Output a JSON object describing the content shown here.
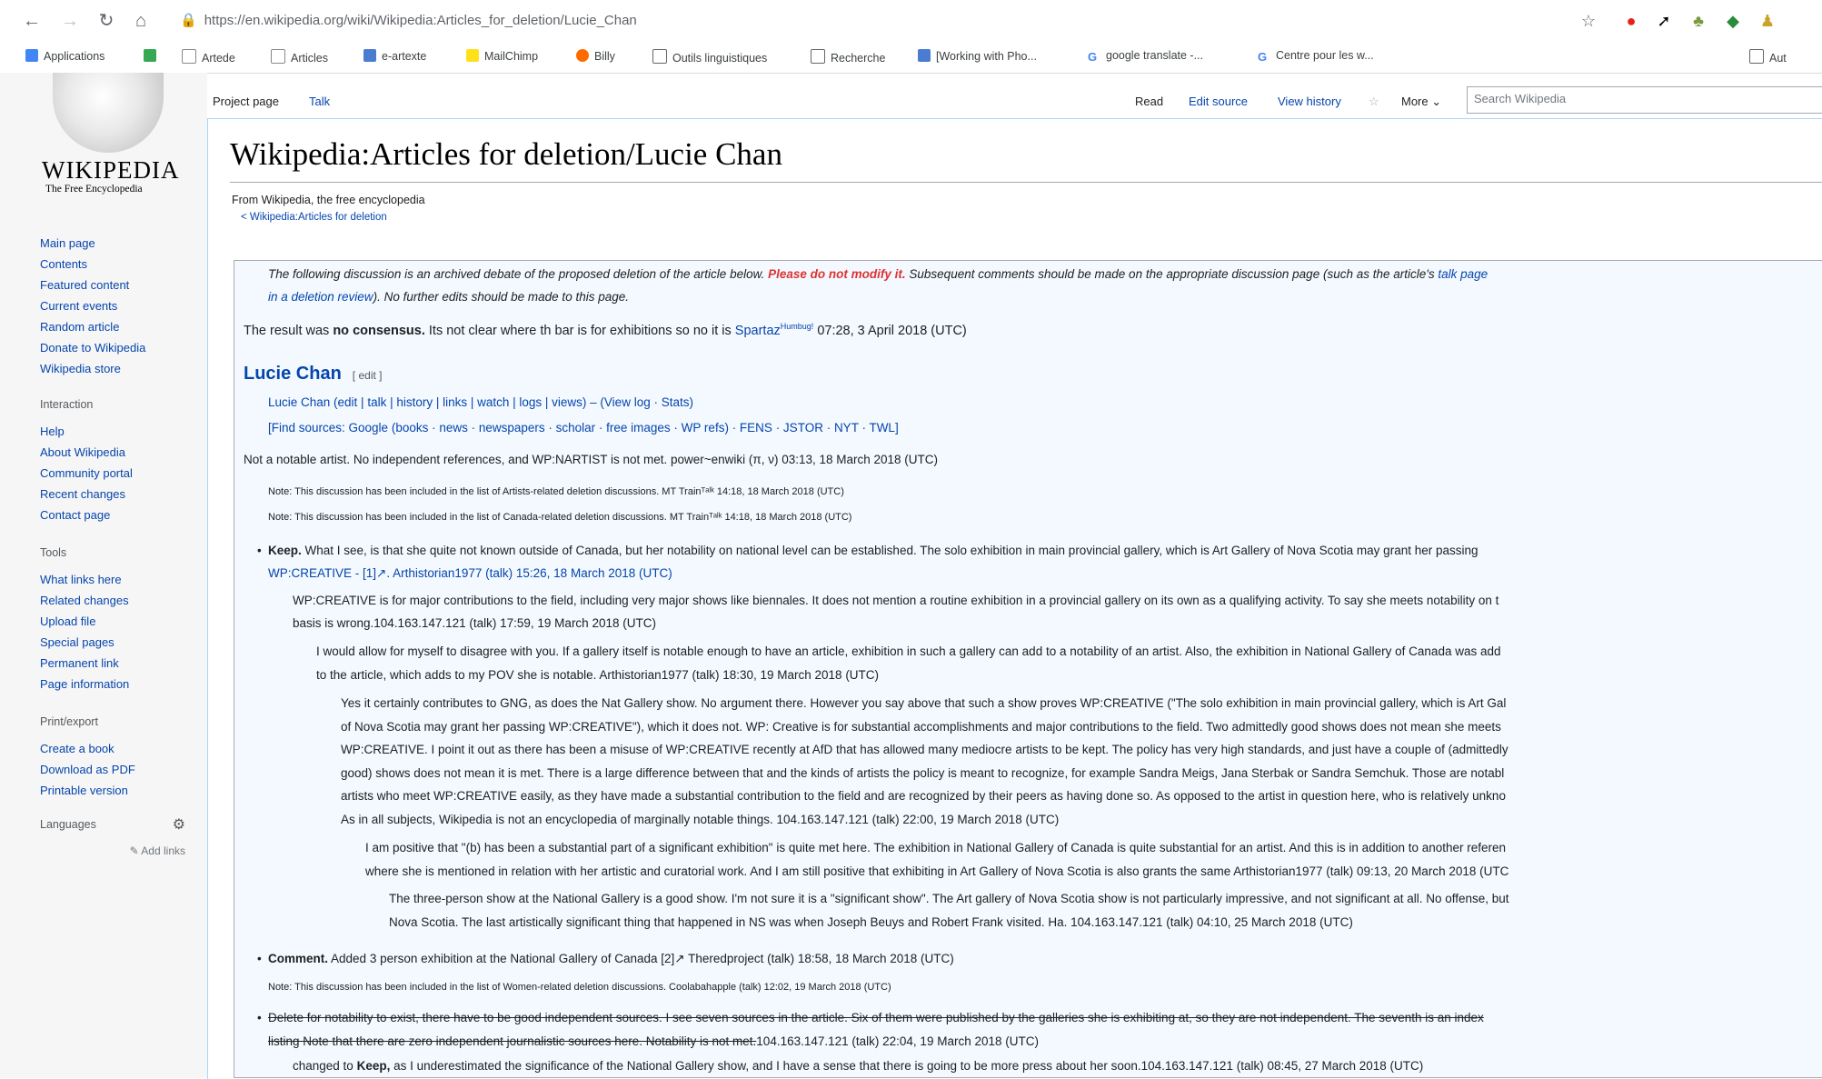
{
  "browser": {
    "url": "https://en.wikipedia.org/wiki/Wikipedia:Articles_for_deletion/Lucie_Chan",
    "bookmarks": [
      "Applications",
      "Artede",
      "Articles",
      "e-artexte",
      "MailChimp",
      "Billy",
      "Outils linguistiques",
      "Recherche",
      "[Working with Pho...",
      "google translate -...",
      "Centre pour les w..."
    ],
    "bookmarks_right": "Aut"
  },
  "logo": {
    "wordmark": "WIKIPEDIA",
    "tagline": "The Free Encyclopedia"
  },
  "sidebar": {
    "nav": [
      "Main page",
      "Contents",
      "Featured content",
      "Current events",
      "Random article",
      "Donate to Wikipedia",
      "Wikipedia store"
    ],
    "interaction_head": "Interaction",
    "interaction": [
      "Help",
      "About Wikipedia",
      "Community portal",
      "Recent changes",
      "Contact page"
    ],
    "tools_head": "Tools",
    "tools": [
      "What links here",
      "Related changes",
      "Upload file",
      "Special pages",
      "Permanent link",
      "Page information"
    ],
    "print_head": "Print/export",
    "print": [
      "Create a book",
      "Download as PDF",
      "Printable version"
    ],
    "languages_head": "Languages",
    "add_links": "Add links"
  },
  "tabs": {
    "project": "Project page",
    "talk": "Talk",
    "read": "Read",
    "edit_source": "Edit source",
    "history": "View history",
    "more": "More",
    "search_placeholder": "Search Wikipedia"
  },
  "page": {
    "title": "Wikipedia:Articles for deletion/Lucie Chan",
    "sitesub": "From Wikipedia, the free encyclopedia",
    "subpages": "< Wikipedia:Articles for deletion"
  },
  "archive": {
    "notice_a": "The following discussion is an archived debate of the proposed deletion of the article below.",
    "notice_red": "Please do not modify it.",
    "notice_b": "Subsequent comments should be made on the appropriate discussion page (such as the article's",
    "notice_link": "talk page",
    "notice_c_link": "in a deletion review",
    "notice_d": "). No further edits should be made to this page.",
    "result_a": "The result was",
    "result_bold": "no consensus.",
    "result_b": "Its not clear where th bar is for exhibitions so no it is",
    "result_user": "Spartaz",
    "result_sup": "Humbug!",
    "result_time": "07:28, 3 April 2018 (UTC)",
    "heading": "Lucie Chan",
    "heading_edit": "[ edit ]",
    "links_row": "Lucie Chan (edit | talk | history | links | watch | logs | views) – (View log · Stats)",
    "sources_row": "[Find sources: Google (books · news · newspapers · scholar · free images · WP refs) · FENS · JSTOR · NYT · TWL]",
    "nom": "Not a notable artist. No independent references, and WP:NARTIST is not met. power~enwiki (π, ν) 03:13, 18 March 2018 (UTC)",
    "note1": "Note: This discussion has been included in the list of Artists-related deletion discussions. MT Trainᵀᵃˡᵏ 14:18, 18 March 2018 (UTC)",
    "note2": "Note: This discussion has been included in the list of Canada-related deletion discussions. MT Trainᵀᵃˡᵏ 14:18, 18 March 2018 (UTC)",
    "keep_bold": "Keep.",
    "keep_1": "What I see, is that she quite not known outside of Canada, but her notability on national level can be established. The solo exhibition in main provincial gallery, which is Art Gallery of Nova Scotia may grant her passing",
    "keep_2": "WP:CREATIVE - [1]↗. Arthistorian1977 (talk) 15:26, 18 March 2018 (UTC)",
    "r1_1": "WP:CREATIVE is for major contributions to the field, including very major shows like biennales. It does not mention a routine exhibition in a provincial gallery on its own as a qualifying activity. To say she meets notability on t",
    "r1_2": "basis is wrong.104.163.147.121 (talk) 17:59, 19 March 2018 (UTC)",
    "r2_1": "I would allow for myself to disagree with you. If a gallery itself is notable enough to have an article, exhibition in such a gallery can add to a notability of an artist. Also, the exhibition in National Gallery of Canada was add",
    "r2_2": "to the article, which adds to my POV she is notable. Arthistorian1977 (talk) 18:30, 19 March 2018 (UTC)",
    "r3_1": "Yes it certainly contributes to GNG, as does the Nat Gallery show. No argument there. However you say above that such a show proves WP:CREATIVE (\"The solo exhibition in main provincial gallery, which is Art Gal",
    "r3_2": "of Nova Scotia may grant her passing WP:CREATIVE\"), which it does not. WP: Creative is for substantial accomplishments and major contributions to the field. Two admittedly good shows does not mean she meets",
    "r3_3": "WP:CREATIVE. I point it out as there has been a misuse of WP:CREATIVE recently at AfD that has allowed many mediocre artists to be kept. The policy has very high standards, and just have a couple of (admittedly",
    "r3_4": "good) shows does not mean it is met. There is a large difference between that and the kinds of artists the policy is meant to recognize, for example Sandra Meigs, Jana Sterbak or Sandra Semchuk. Those are notabl",
    "r3_5": "artists who meet WP:CREATIVE easily, as they have made a substantial contribution to the field and are recognized by their peers as having done so. As opposed to the artist in question here, who is relatively unkno",
    "r3_6": "As in all subjects, Wikipedia is not an encyclopedia of marginally notable things. 104.163.147.121 (talk) 22:00, 19 March 2018 (UTC)",
    "r4_1": "I am positive that \"(b) has been a substantial part of a significant exhibition\" is quite met here. The exhibition in National Gallery of Canada is quite substantial for an artist. And this is in addition to another referen",
    "r4_2": "where she is mentioned in relation with her artistic and curatorial work. And I am still positive that exhibiting in Art Gallery of Nova Scotia is also grants the same Arthistorian1977 (talk) 09:13, 20 March 2018 (UTC",
    "r5_1": "The three-person show at the National Gallery is a good show. I'm not sure it is a \"significant show\". The Art gallery of Nova Scotia show is not particularly impressive, and not significant at all. No offense, but",
    "r5_2": "Nova Scotia. The last artistically significant thing that happened in NS was when Joseph Beuys and Robert Frank visited. Ha. 104.163.147.121 (talk) 04:10, 25 March 2018 (UTC)",
    "comment_bold": "Comment.",
    "comment_text": "Added 3 person exhibition at the National Gallery of Canada [2]↗ Theredproject (talk) 18:58, 18 March 2018 (UTC)",
    "note3": "Note: This discussion has been included in the list of Women-related deletion discussions. Coolabahapple (talk) 12:02, 19 March 2018 (UTC)",
    "delete_1": "Delete for notability to exist, there have to be good independent sources. I see seven sources in the article. Six of them were published by the galleries she is exhibiting at, so they are not independent. The seventh is an index",
    "delete_2": "listing Note that there are zero independent journalistic sources here. Notability is not met.",
    "delete_2b": "104.163.147.121 (talk) 22:04, 19 March 2018 (UTC)",
    "changed_a": "changed to",
    "changed_bold": "Keep,",
    "changed_b": "as I underestimated the significance of the National Gallery show, and I have a sense that there is going to be more press about her soon.104.163.147.121 (talk) 08:45, 27 March 2018 (UTC)"
  }
}
